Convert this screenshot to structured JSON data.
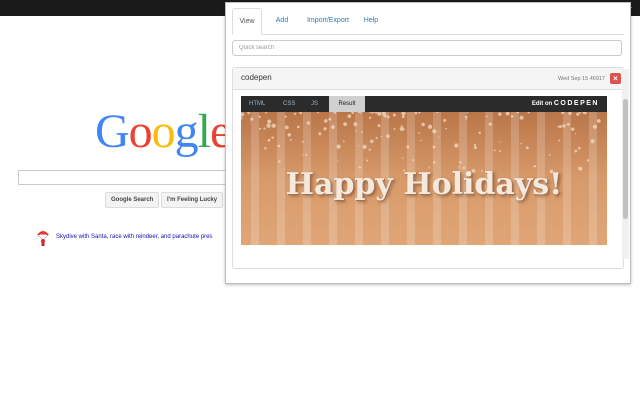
{
  "topbar": {
    "menu_icon": "double-chevron-right-icon"
  },
  "google": {
    "logo_letters": [
      {
        "char": "G",
        "color": "#4285f4"
      },
      {
        "char": "o",
        "color": "#ea4335"
      },
      {
        "char": "o",
        "color": "#fbbc05"
      },
      {
        "char": "g",
        "color": "#4285f4"
      },
      {
        "char": "l",
        "color": "#34a853"
      },
      {
        "char": "e",
        "color": "#ea4335"
      }
    ],
    "search_button": "Google Search",
    "lucky_button": "I'm Feeling Lucky",
    "doodle_text": "Skydive with Santa, race with reindeer, and parachute pres",
    "doodle_icon": "santa-parachute-icon"
  },
  "popup": {
    "tabs": [
      {
        "label": "View",
        "active": true
      },
      {
        "label": "Add",
        "active": false
      },
      {
        "label": "Import/Export",
        "active": false
      },
      {
        "label": "Help",
        "active": false
      }
    ],
    "search": {
      "placeholder": "Quick search",
      "value": ""
    },
    "entry": {
      "title": "codepen",
      "date": "Wed Sep 15 46917",
      "delete_icon": "close-icon",
      "embed": {
        "tabs": [
          {
            "label": "HTML",
            "active": false
          },
          {
            "label": "CSS",
            "active": false
          },
          {
            "label": "JS",
            "active": false
          },
          {
            "label": "Result",
            "active": true
          }
        ],
        "edit_prefix": "Edit on",
        "brand": "CODEPEN",
        "result_text": "Happy Holidays!",
        "colors": {
          "background": "#c88c5c",
          "text": "#f3e9df"
        }
      }
    }
  }
}
